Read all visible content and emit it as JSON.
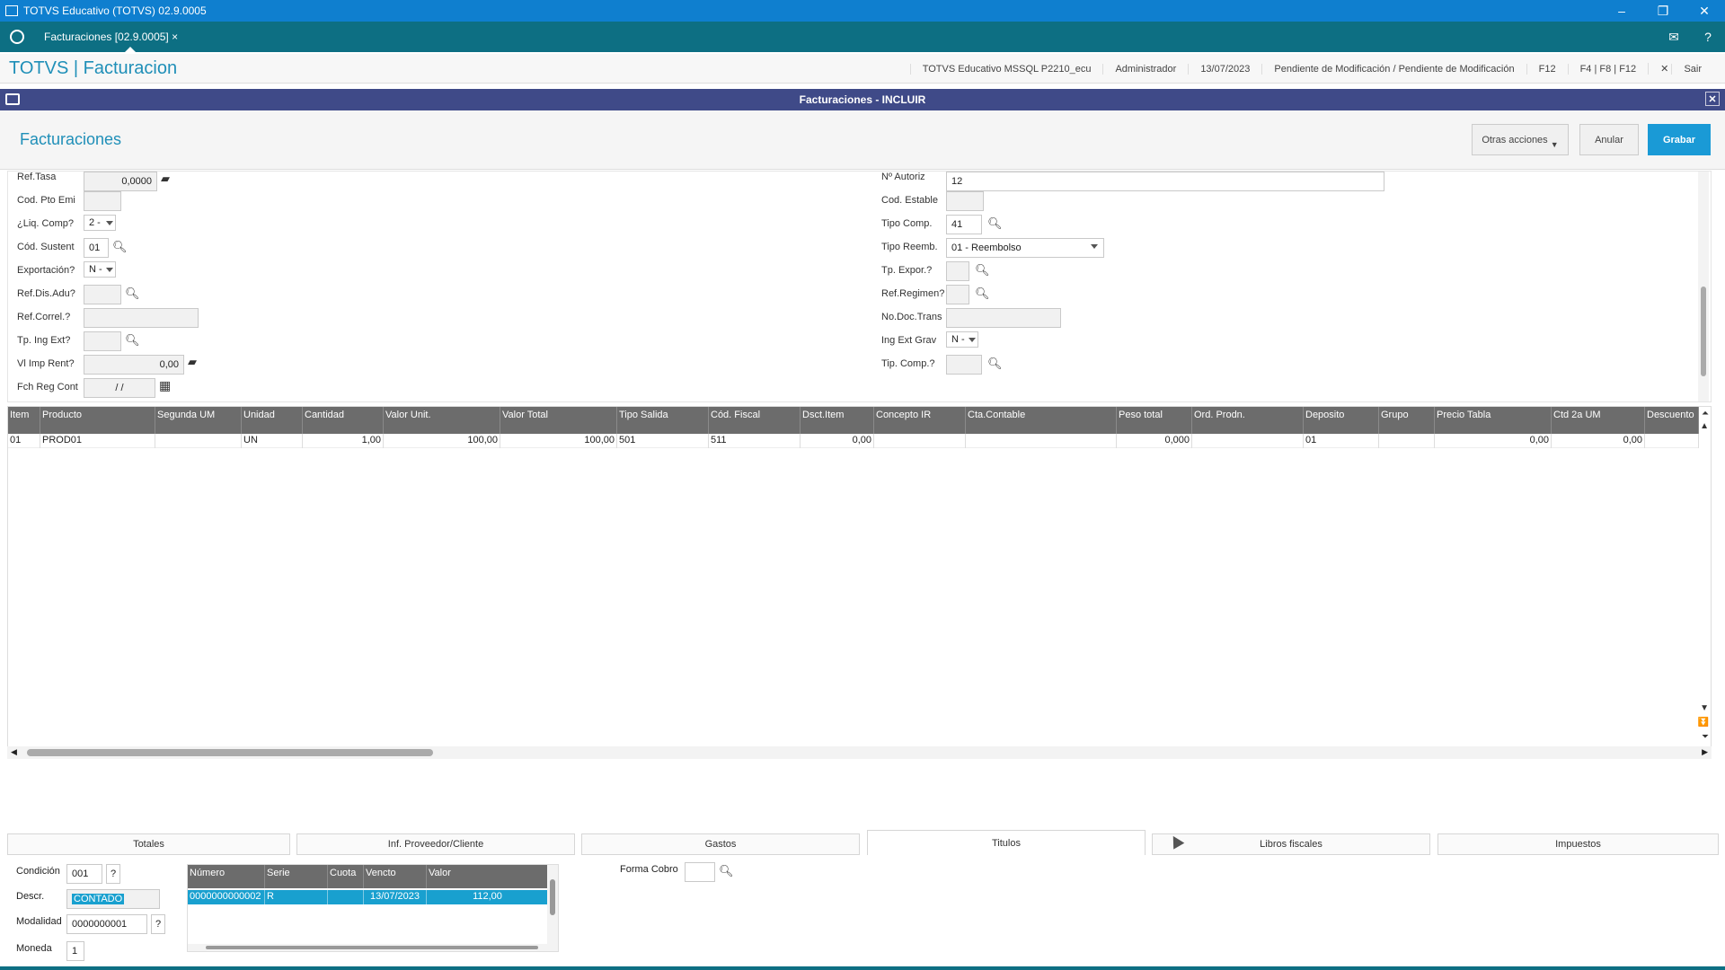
{
  "window": {
    "title": "TOTVS Educativo (TOTVS) 02.9.0005"
  },
  "tab": {
    "label": "Facturaciones [02.9.0005]",
    "close": "×"
  },
  "header": {
    "brand": "TOTVS | Facturacion",
    "env": "TOTVS Educativo MSSQL P2210_ecu",
    "user": "Administrador",
    "date": "13/07/2023",
    "status": "Pendiente de Modificación / Pendiente de Modificación",
    "keys1": "F12",
    "keys2": "F4 | F8 | F12",
    "exit": "Sair"
  },
  "dialog": {
    "title": "Facturaciones - INCLUIR",
    "heading": "Facturaciones",
    "btn_other": "Otras acciones",
    "btn_cancel": "Anular",
    "btn_save": "Grabar"
  },
  "form": {
    "left": [
      {
        "label": "Ref.Tasa",
        "value": "0,0000"
      },
      {
        "label": "Cod. Pto Emi",
        "value": ""
      },
      {
        "label": "¿Liq. Comp?",
        "value": "2 -"
      },
      {
        "label": "Cód. Sustent",
        "value": "01"
      },
      {
        "label": "Exportación?",
        "value": "N -"
      },
      {
        "label": "Ref.Dis.Adu?",
        "value": ""
      },
      {
        "label": "Ref.Correl.?",
        "value": ""
      },
      {
        "label": "Tp. Ing Ext?",
        "value": ""
      },
      {
        "label": "Vl Imp Rent?",
        "value": "0,00"
      },
      {
        "label": "Fch Reg Cont",
        "value": "/ /"
      }
    ],
    "right": [
      {
        "label": "Nº Autoriz",
        "value": "12"
      },
      {
        "label": "Cod. Estable",
        "value": ""
      },
      {
        "label": "Tipo Comp.",
        "value": "41"
      },
      {
        "label": "Tipo Reemb.",
        "value": "01 - Reembolso"
      },
      {
        "label": "Tp. Expor.?",
        "value": ""
      },
      {
        "label": "Ref.Regimen?",
        "value": ""
      },
      {
        "label": "No.Doc.Trans",
        "value": ""
      },
      {
        "label": "Ing Ext Grav",
        "value": "N -"
      },
      {
        "label": "Tip. Comp.?",
        "value": ""
      }
    ]
  },
  "grid": {
    "columns": [
      "Item",
      "Producto",
      "Segunda UM",
      "Unidad",
      "Cantidad",
      "Valor Unit.",
      "Valor Total",
      "Tipo Salida",
      "Cód. Fiscal",
      "Dsct.Item",
      "Concepto IR",
      "Cta.Contable",
      "Peso total",
      "Ord. Prodn.",
      "Deposito",
      "Grupo",
      "Precio Tabla",
      "Ctd 2a UM",
      "Descuento"
    ],
    "row": [
      "01",
      "PROD01",
      "",
      "UN",
      "1,00",
      "100,00",
      "100,00",
      "501",
      "511",
      "0,00",
      "",
      "",
      "0,000",
      "",
      "01",
      "",
      "0,00",
      "0,00",
      ""
    ]
  },
  "tabs": [
    "Totales",
    "Inf. Proveedor/Cliente",
    "Gastos",
    "Titulos",
    "Libros fiscales",
    "Impuestos"
  ],
  "bottom": {
    "condicion_label": "Condición",
    "condicion_value": "001",
    "q": "?",
    "descr_label": "Descr.",
    "descr_value": "CONTADO",
    "modalidad_label": "Modalidad",
    "modalidad_value": "0000000001",
    "moneda_label": "Moneda",
    "moneda_value": "1",
    "forma_label": "Forma Cobro",
    "tcols": [
      "Número",
      "Serie",
      "Cuota",
      "Vencto",
      "Valor"
    ],
    "trow": [
      "0000000000002",
      "R",
      "",
      "13/07/2023",
      "112,00"
    ]
  }
}
